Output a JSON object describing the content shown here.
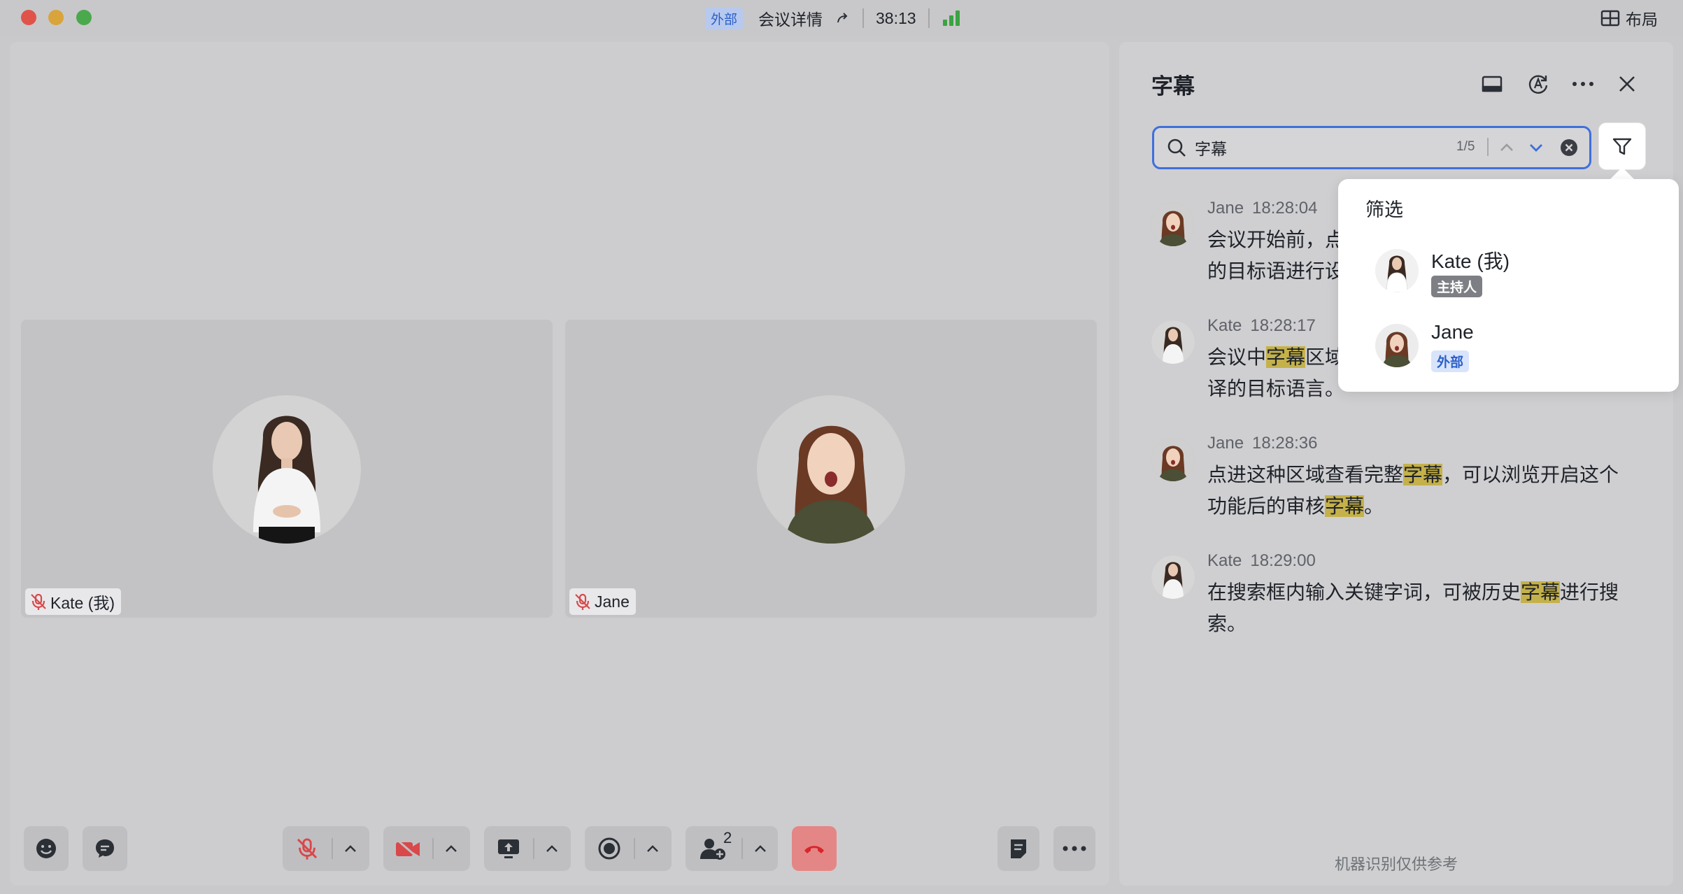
{
  "titlebar": {
    "external_badge": "外部",
    "meeting_details": "会议详情",
    "timer": "38:13",
    "layout_label": "布局"
  },
  "participants": [
    {
      "name": "Kate (我)",
      "muted": true
    },
    {
      "name": "Jane",
      "muted": true
    }
  ],
  "toolbar": {
    "participants_count": "2",
    "icons": [
      "emoji-icon",
      "chat-icon",
      "mic-muted-icon",
      "camera-off-icon",
      "share-screen-icon",
      "record-icon",
      "add-participant-icon",
      "end-call-icon",
      "notes-icon",
      "more-icon"
    ]
  },
  "captions_panel": {
    "title": "字幕",
    "search": {
      "value": "字幕",
      "placeholder": "",
      "count": "1/5"
    },
    "messages": [
      {
        "speaker": "Jane",
        "time": "18:28:04",
        "lines": [
          "会议开始前，点",
          "的目标语进行设"
        ]
      },
      {
        "speaker": "Kate",
        "time": "18:28:17",
        "lines_parts": [
          [
            "会议中",
            "字幕",
            "区域"
          ],
          [
            "译的目标语言。"
          ]
        ]
      },
      {
        "speaker": "Jane",
        "time": "18:28:36",
        "parts": [
          "点进这种区域查看完整",
          "字幕",
          "，可以浏览开启这个功能后的审核",
          "字幕",
          "。"
        ]
      },
      {
        "speaker": "Kate",
        "time": "18:29:00",
        "parts": [
          "在搜索框内输入关键字词，可被历史",
          "字幕",
          "进行搜索。"
        ]
      }
    ],
    "disclaimer": "机器识别仅供参考"
  },
  "filter_popover": {
    "title": "筛选",
    "items": [
      {
        "name": "Kate (我)",
        "badge": "主持人"
      },
      {
        "name": "Jane",
        "badge": "外部"
      }
    ]
  },
  "colors": {
    "accent_blue": "#3f6fdc",
    "signal_green": "#3aa342",
    "highlight": "#c4b14a",
    "end_call_red": "#e86a6a"
  }
}
